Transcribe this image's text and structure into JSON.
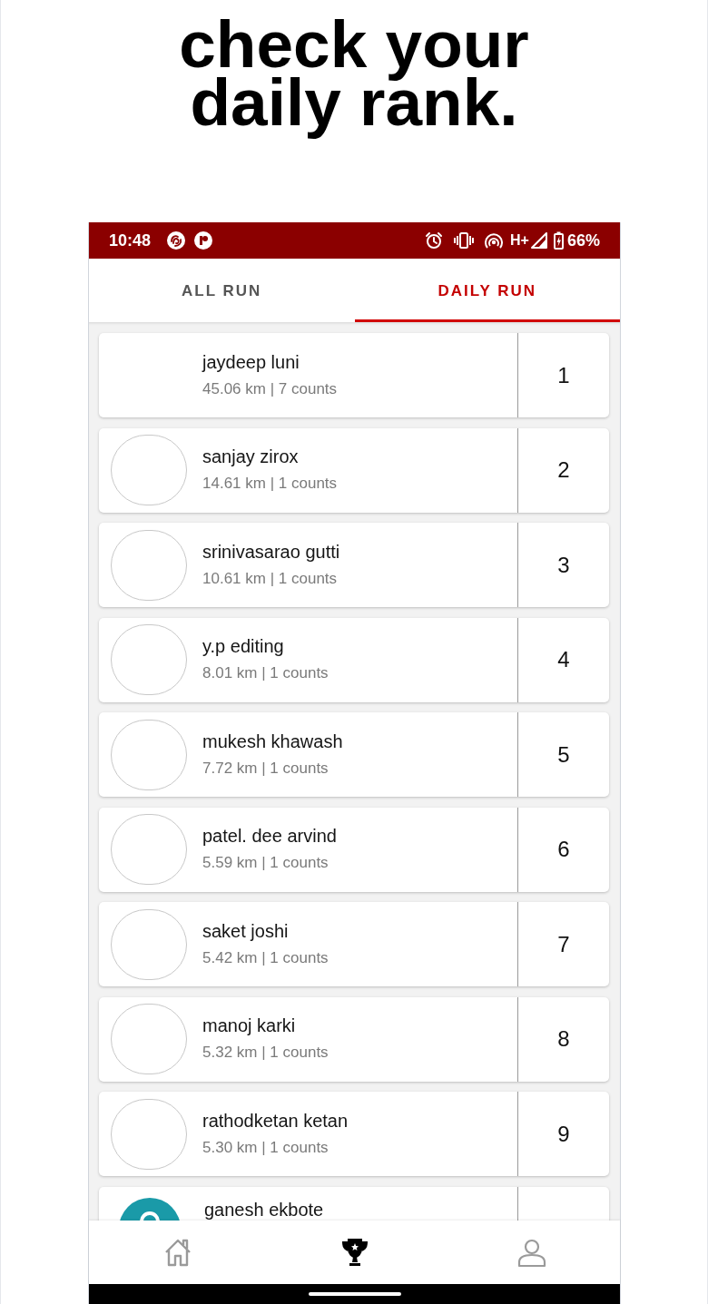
{
  "headline": {
    "lines": [
      "check your",
      "daily rank."
    ]
  },
  "status_bar": {
    "time": "10:48",
    "network": "H+",
    "battery": "66%"
  },
  "tabs": [
    {
      "label": "ALL RUN",
      "selected": false
    },
    {
      "label": "DAILY RUN",
      "selected": true
    }
  ],
  "leaderboard": [
    {
      "kind": "blank",
      "name": "jaydeep luni",
      "stats": "45.06 km | 7 counts",
      "rank": "1"
    },
    {
      "kind": "outline",
      "name": "sanjay zirox",
      "stats": "14.61 km | 1 counts",
      "rank": "2"
    },
    {
      "kind": "outline",
      "name": "srinivasarao gutti",
      "stats": "10.61 km | 1 counts",
      "rank": "3"
    },
    {
      "kind": "outline",
      "name": "y.p editing",
      "stats": "8.01 km | 1 counts",
      "rank": "4"
    },
    {
      "kind": "outline",
      "name": "mukesh khawash",
      "stats": "7.72 km | 1 counts",
      "rank": "5"
    },
    {
      "kind": "outline",
      "name": "patel. dee arvind",
      "stats": "5.59 km | 1 counts",
      "rank": "6"
    },
    {
      "kind": "outline",
      "name": "saket joshi",
      "stats": "5.42 km | 1 counts",
      "rank": "7"
    },
    {
      "kind": "outline",
      "name": "manoj karki",
      "stats": "5.32 km | 1 counts",
      "rank": "8"
    },
    {
      "kind": "outline",
      "name": "rathodketan ketan",
      "stats": "5.30 km | 1 counts",
      "rank": "9"
    },
    {
      "kind": "silhouette",
      "name": "ganesh ekbote"
    }
  ],
  "bottom_nav": [
    {
      "kind": "home",
      "selected": false
    },
    {
      "kind": "trophy",
      "selected": true
    },
    {
      "kind": "profile",
      "selected": false
    }
  ]
}
